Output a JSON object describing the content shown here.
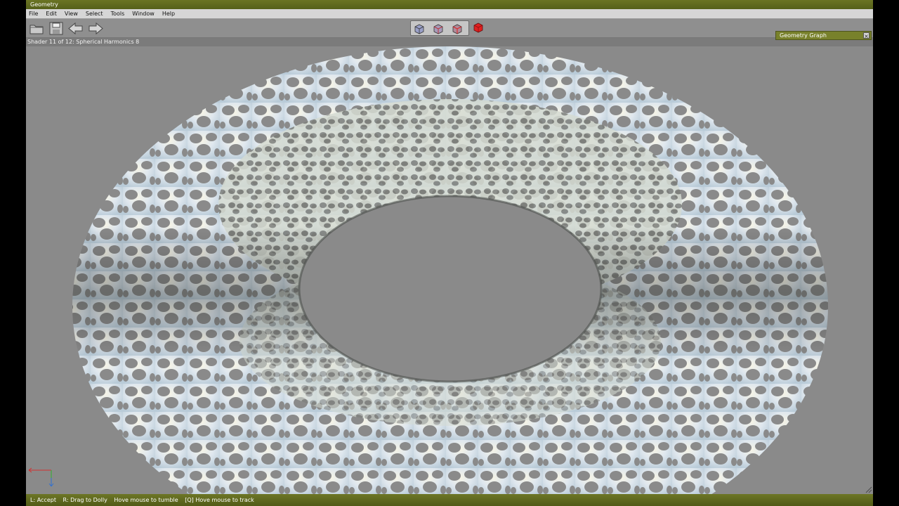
{
  "window": {
    "title": "Geometry"
  },
  "menu": [
    "File",
    "Edit",
    "View",
    "Select",
    "Tools",
    "Window",
    "Help"
  ],
  "toolbar": {
    "icons": [
      "open-folder-icon",
      "save-icon",
      "back-arrow-icon",
      "forward-arrow-icon"
    ],
    "view_modes": [
      "wireframe-cube-icon",
      "wire-shaded-cube-icon",
      "wire-red-cube-icon",
      "solid-red-cube-icon"
    ]
  },
  "status_line": "Shader 11 of 12: Spherical Harmonics 8",
  "panel": {
    "title": "Geometry Graph",
    "close": "×"
  },
  "hints": [
    "L: Accept",
    "R: Drag to Dolly",
    "Hove mouse to tumble",
    "[Q] Hove mouse to track"
  ],
  "colors": {
    "title_bar": "#606b1f",
    "viewport_bg": "#8a8a8a",
    "surface": "#e8eef2",
    "accent_red": "#e02020"
  }
}
